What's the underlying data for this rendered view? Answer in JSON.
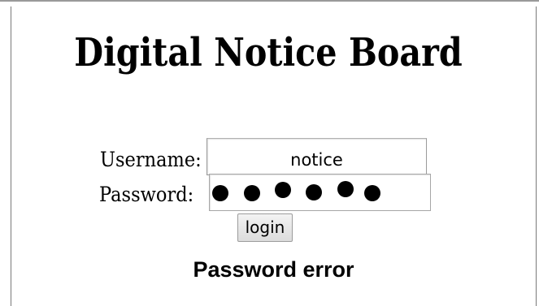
{
  "header": {
    "title": "Digital Notice Board"
  },
  "login_form": {
    "username_label": "Username:",
    "username_value": "notice",
    "password_label": "Password:",
    "password_masked_count": 6,
    "login_label": "login"
  },
  "status": {
    "error_message": "Password error"
  }
}
